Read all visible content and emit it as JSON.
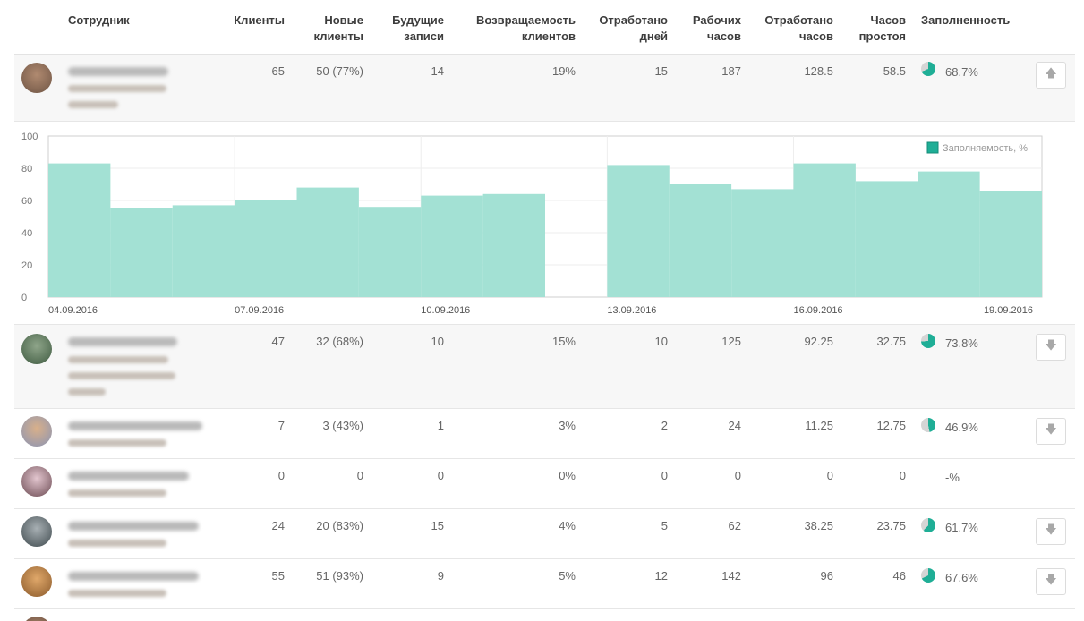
{
  "header": {
    "employee": "Сотрудник",
    "clients": "Клиенты",
    "new_clients": [
      "Новые",
      "клиенты"
    ],
    "future": [
      "Будущие",
      "записи"
    ],
    "return": [
      "Возвращаемость",
      "клиентов"
    ],
    "days": [
      "Отработано",
      "дней"
    ],
    "work_hours": [
      "Рабочих",
      "часов"
    ],
    "worked_hours": [
      "Отработано",
      "часов"
    ],
    "idle": [
      "Часов",
      "простоя"
    ],
    "fill": "Заполненность"
  },
  "rows": [
    {
      "clients": "65",
      "new_clients": "50 (77%)",
      "future": "14",
      "return": "19%",
      "days": "15",
      "work_hours": "187",
      "worked_hours": "128.5",
      "idle": "58.5",
      "fill": "68.7%",
      "fill_pct": 68.7,
      "button": "up-arrow-icon"
    },
    {
      "clients": "47",
      "new_clients": "32 (68%)",
      "future": "10",
      "return": "15%",
      "days": "10",
      "work_hours": "125",
      "worked_hours": "92.25",
      "idle": "32.75",
      "fill": "73.8%",
      "fill_pct": 73.8,
      "button": "down-arrow-icon"
    },
    {
      "clients": "7",
      "new_clients": "3 (43%)",
      "future": "1",
      "return": "3%",
      "days": "2",
      "work_hours": "24",
      "worked_hours": "11.25",
      "idle": "12.75",
      "fill": "46.9%",
      "fill_pct": 46.9,
      "button": "down-arrow-icon"
    },
    {
      "clients": "0",
      "new_clients": "0",
      "future": "0",
      "return": "0%",
      "days": "0",
      "work_hours": "0",
      "worked_hours": "0",
      "idle": "0",
      "fill": "-%",
      "fill_pct": null,
      "button": null
    },
    {
      "clients": "24",
      "new_clients": "20 (83%)",
      "future": "15",
      "return": "4%",
      "days": "5",
      "work_hours": "62",
      "worked_hours": "38.25",
      "idle": "23.75",
      "fill": "61.7%",
      "fill_pct": 61.7,
      "button": "down-arrow-icon"
    },
    {
      "clients": "55",
      "new_clients": "51 (93%)",
      "future": "9",
      "return": "5%",
      "days": "12",
      "work_hours": "142",
      "worked_hours": "96",
      "idle": "46",
      "fill": "67.6%",
      "fill_pct": 67.6,
      "button": "down-arrow-icon"
    }
  ],
  "colors": {
    "accent": "#1fae96",
    "bar": "#a3e1d4",
    "pie_bg": "#d5d5d5"
  },
  "chart_data": {
    "type": "bar",
    "categories": [
      "04.09.2016",
      "05.09.2016",
      "06.09.2016",
      "07.09.2016",
      "08.09.2016",
      "09.09.2016",
      "10.09.2016",
      "11.09.2016",
      "12.09.2016",
      "13.09.2016",
      "14.09.2016",
      "15.09.2016",
      "16.09.2016",
      "17.09.2016",
      "18.09.2016",
      "19.09.2016"
    ],
    "tick_labels": [
      "04.09.2016",
      "07.09.2016",
      "10.09.2016",
      "13.09.2016",
      "16.09.2016",
      "19.09.2016"
    ],
    "series": [
      {
        "name": "Заполняемость, %",
        "values": [
          83,
          55,
          57,
          60,
          68,
          56,
          63,
          64,
          0,
          82,
          70,
          67,
          83,
          72,
          78,
          66
        ]
      }
    ],
    "yticks": [
      "0",
      "20",
      "40",
      "60",
      "80",
      "100"
    ],
    "ylim": [
      0,
      100
    ],
    "grid": true,
    "legend": "top-right"
  }
}
